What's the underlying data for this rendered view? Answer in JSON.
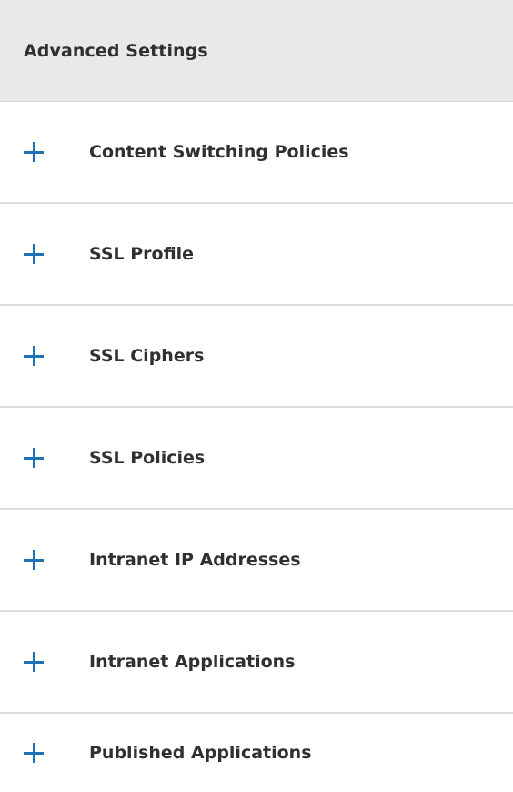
{
  "panel": {
    "title": "Advanced Settings",
    "sections": [
      {
        "label": "Content Switching Policies",
        "icon": "plus-icon"
      },
      {
        "label": "SSL Profile",
        "icon": "plus-icon"
      },
      {
        "label": "SSL Ciphers",
        "icon": "plus-icon"
      },
      {
        "label": "SSL Policies",
        "icon": "plus-icon"
      },
      {
        "label": "Intranet IP Addresses",
        "icon": "plus-icon"
      },
      {
        "label": "Intranet Applications",
        "icon": "plus-icon"
      },
      {
        "label": "Published Applications",
        "icon": "plus-icon"
      }
    ]
  },
  "colors": {
    "accent": "#1e73b8",
    "header_background": "#e9e9e9",
    "divider": "#dddddd"
  }
}
